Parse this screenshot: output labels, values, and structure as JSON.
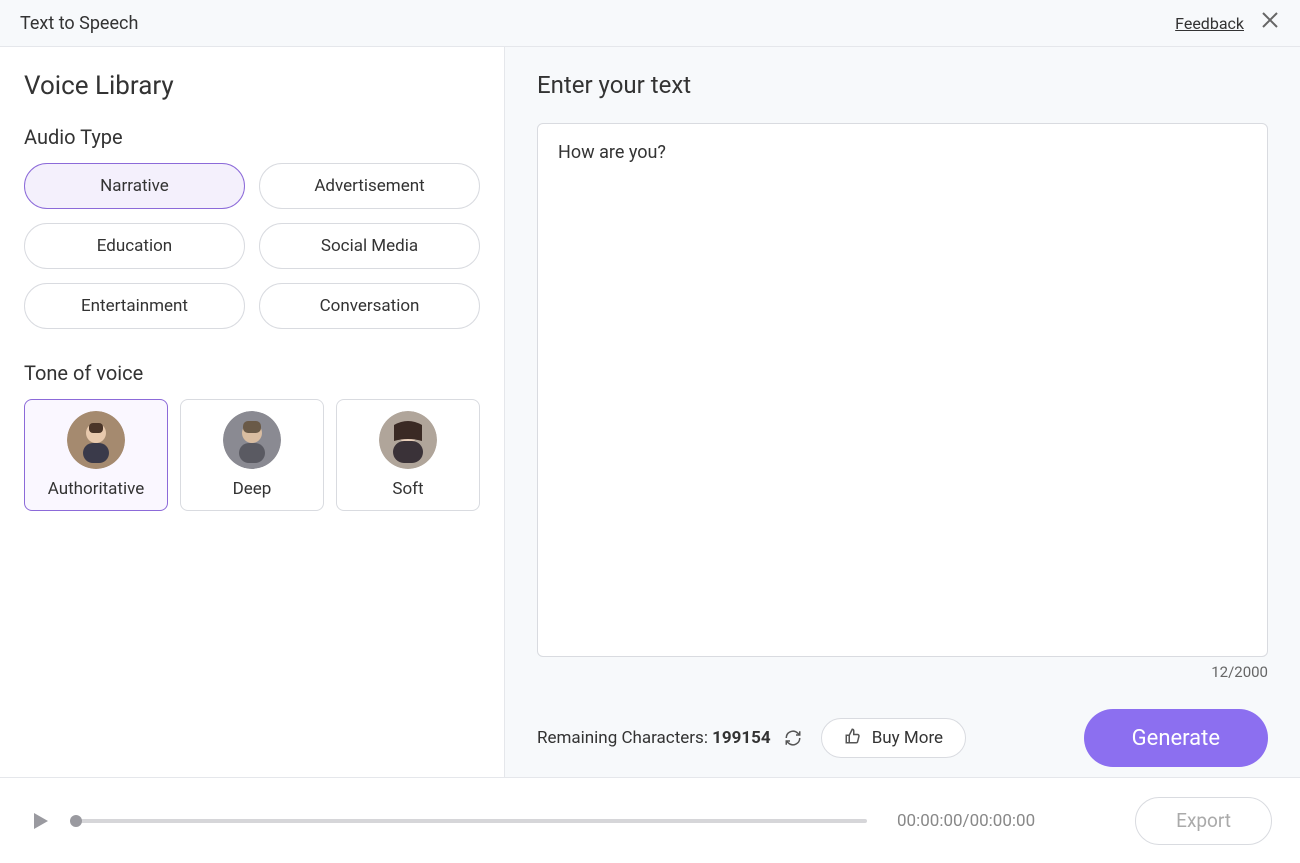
{
  "header": {
    "title": "Text to Speech",
    "feedback": "Feedback"
  },
  "sidebar": {
    "title": "Voice Library",
    "audio_type_label": "Audio Type",
    "audio_types": [
      "Narrative",
      "Advertisement",
      "Education",
      "Social Media",
      "Entertainment",
      "Conversation"
    ],
    "tone_label": "Tone of voice",
    "tones": [
      "Authoritative",
      "Deep",
      "Soft"
    ]
  },
  "content": {
    "title": "Enter your text",
    "input_value": "How are you?",
    "char_counter": "12/2000",
    "remaining_label": "Remaining Characters:",
    "remaining_value": "199154",
    "buy_more_label": "Buy More",
    "generate_label": "Generate"
  },
  "player": {
    "time": "00:00:00/00:00:00",
    "export_label": "Export"
  }
}
